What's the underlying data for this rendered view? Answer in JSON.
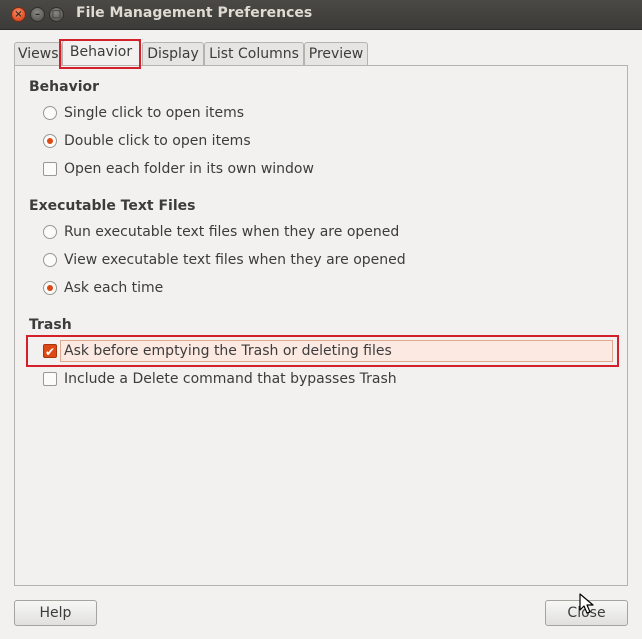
{
  "window": {
    "title": "File Management Preferences"
  },
  "tabs": [
    {
      "label": "Views"
    },
    {
      "label": "Behavior"
    },
    {
      "label": "Display"
    },
    {
      "label": "List Columns"
    },
    {
      "label": "Preview"
    }
  ],
  "active_tab": "Behavior",
  "behavior": {
    "title": "Behavior",
    "options": [
      {
        "label": "Single click to open items",
        "selected": false
      },
      {
        "label": "Double click to open items",
        "selected": true
      }
    ],
    "open_folder": {
      "label": "Open each folder in its own window",
      "checked": false
    }
  },
  "executable": {
    "title": "Executable Text Files",
    "options": [
      {
        "label": "Run executable text files when they are opened",
        "selected": false
      },
      {
        "label": "View executable text files when they are opened",
        "selected": false
      },
      {
        "label": "Ask each time",
        "selected": true
      }
    ]
  },
  "trash": {
    "title": "Trash",
    "ask_before": {
      "label": "Ask before emptying the Trash or deleting files",
      "checked": true
    },
    "include_delete": {
      "label": "Include a Delete command that bypasses Trash",
      "checked": false
    }
  },
  "buttons": {
    "help": "Help",
    "close": "Close"
  },
  "colors": {
    "accent": "#dd4814",
    "highlight": "#d4202b",
    "titlebar": "#3c3b37"
  },
  "icons": [
    "window-close-icon",
    "window-minimize-icon",
    "window-maximize-icon",
    "mouse-cursor-icon"
  ]
}
